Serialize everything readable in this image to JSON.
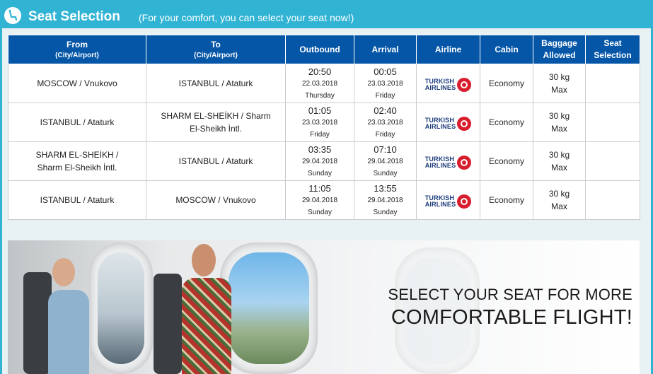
{
  "header": {
    "title": "Seat Selection",
    "subtitle": "(For your comfort, you can select your seat now!)"
  },
  "table": {
    "headers": {
      "from": "From",
      "from_sub": "(City/Airport)",
      "to": "To",
      "to_sub": "(City/Airport)",
      "outbound": "Outbound",
      "arrival": "Arrival",
      "airline": "Airline",
      "cabin": "Cabin",
      "baggage_line1": "Baggage",
      "baggage_line2": "Allowed",
      "seat_line1": "Seat",
      "seat_line2": "Selection"
    },
    "rows": [
      {
        "from": "MOSCOW / Vnukovo",
        "to": "ISTANBUL / Ataturk",
        "out_time": "20:50",
        "out_date": "22.03.2018",
        "out_day": "Thursday",
        "arr_time": "00:05",
        "arr_date": "23.03.2018",
        "arr_day": "Friday",
        "airline_line1": "TURKISH",
        "airline_line2": "AIRLINES",
        "cabin": "Economy",
        "baggage_line1": "30 kg",
        "baggage_line2": "Max",
        "seat": ""
      },
      {
        "from": "ISTANBUL / Ataturk",
        "to": "SHARM EL-SHEİKH / Sharm El-Sheikh İntl.",
        "out_time": "01:05",
        "out_date": "23.03.2018",
        "out_day": "Friday",
        "arr_time": "02:40",
        "arr_date": "23.03.2018",
        "arr_day": "Friday",
        "airline_line1": "TURKISH",
        "airline_line2": "AIRLINES",
        "cabin": "Economy",
        "baggage_line1": "30 kg",
        "baggage_line2": "Max",
        "seat": ""
      },
      {
        "from": "SHARM EL-SHEİKH / Sharm El-Sheikh İntl.",
        "to": "ISTANBUL / Ataturk",
        "out_time": "03:35",
        "out_date": "29.04.2018",
        "out_day": "Sunday",
        "arr_time": "07:10",
        "arr_date": "29.04.2018",
        "arr_day": "Sunday",
        "airline_line1": "TURKISH",
        "airline_line2": "AIRLINES",
        "cabin": "Economy",
        "baggage_line1": "30 kg",
        "baggage_line2": "Max",
        "seat": ""
      },
      {
        "from": "ISTANBUL / Ataturk",
        "to": "MOSCOW / Vnukovo",
        "out_time": "11:05",
        "out_date": "29.04.2018",
        "out_day": "Sunday",
        "arr_time": "13:55",
        "arr_date": "29.04.2018",
        "arr_day": "Sunday",
        "airline_line1": "TURKISH",
        "airline_line2": "AIRLINES",
        "cabin": "Economy",
        "baggage_line1": "30 kg",
        "baggage_line2": "Max",
        "seat": ""
      }
    ]
  },
  "banner": {
    "line1": "SELECT YOUR SEAT FOR MORE",
    "line2": "COMFORTABLE FLIGHT!"
  },
  "colors": {
    "header_bg": "#31b4d4",
    "table_header_bg": "#0556a7",
    "airline_red": "#d81e2c",
    "airline_navy": "#1a3a7a"
  },
  "icons": {
    "header_icon": "seat-icon",
    "airline_logo": "turkish-airlines-logo"
  }
}
